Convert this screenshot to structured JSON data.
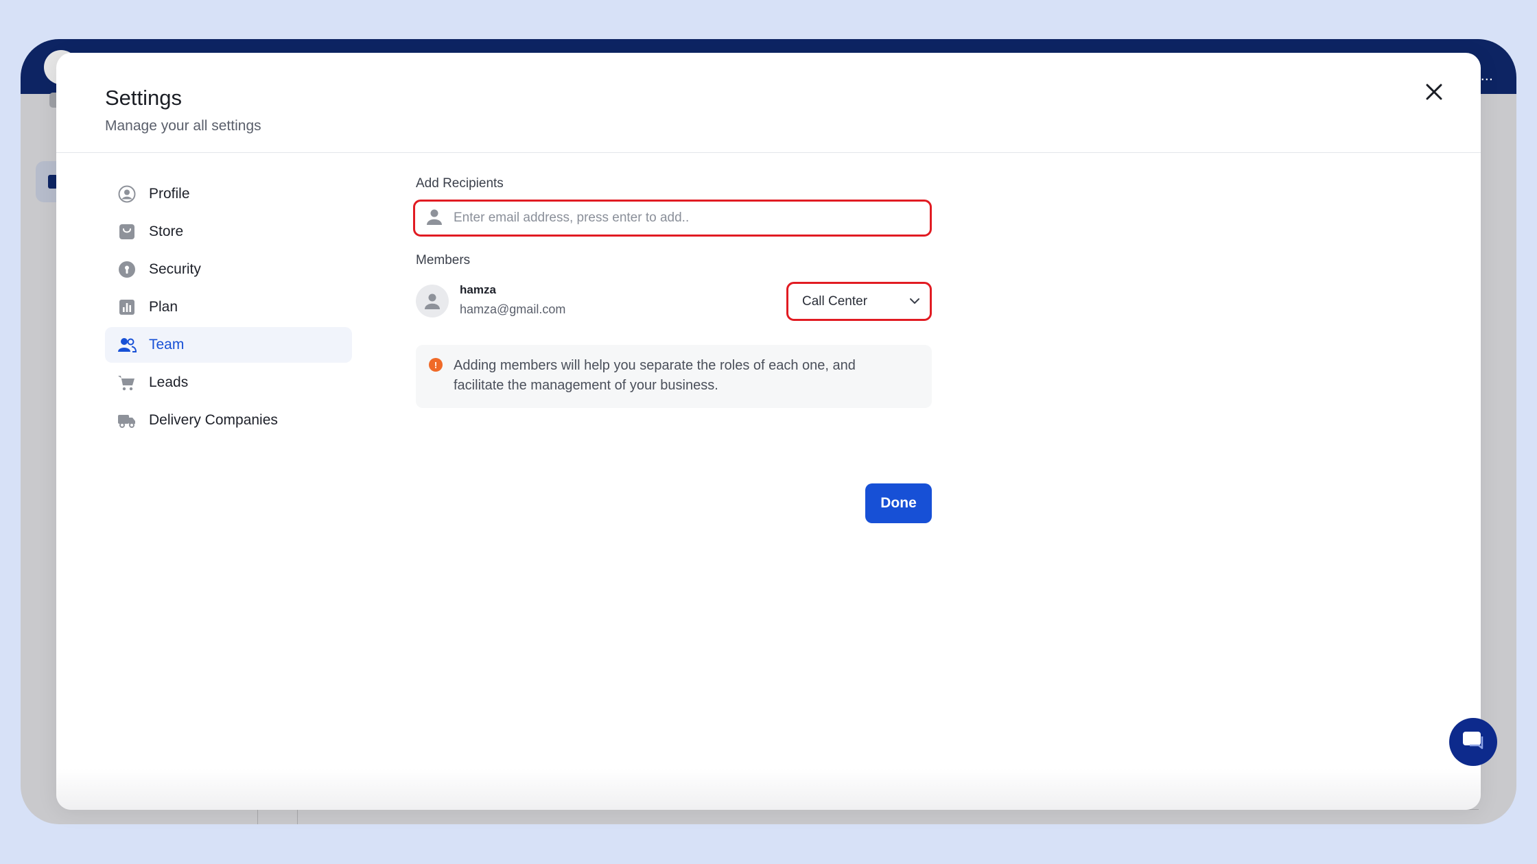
{
  "app": {
    "topbar_overflow": "..."
  },
  "modal": {
    "title": "Settings",
    "subtitle": "Manage your all settings",
    "close_icon": "close-icon"
  },
  "nav": {
    "items": [
      {
        "label": "Profile",
        "icon": "user-circle-icon",
        "active": false
      },
      {
        "label": "Store",
        "icon": "store-bag-icon",
        "active": false
      },
      {
        "label": "Security",
        "icon": "keyhole-icon",
        "active": false
      },
      {
        "label": "Plan",
        "icon": "bar-chart-icon",
        "active": false
      },
      {
        "label": "Team",
        "icon": "users-icon",
        "active": true
      },
      {
        "label": "Leads",
        "icon": "cart-icon",
        "active": false
      },
      {
        "label": "Delivery Companies",
        "icon": "truck-icon",
        "active": false
      }
    ]
  },
  "team": {
    "add_recipients_label": "Add Recipients",
    "recipients_placeholder": "Enter email address, press enter to add..",
    "recipients_value": "",
    "members_label": "Members",
    "members": [
      {
        "name": "hamza",
        "email": "hamza@gmail.com",
        "role": "Call Center"
      }
    ],
    "info_text": "Adding members will help you separate the roles of each one, and facilitate the management of your business.",
    "info_icon": "!",
    "done_label": "Done"
  },
  "colors": {
    "accent": "#1750d6",
    "highlight_border": "#e11b22",
    "info_icon": "#f06a28",
    "topbar": "#0d2463",
    "chat_launcher": "#0d2a8c"
  }
}
